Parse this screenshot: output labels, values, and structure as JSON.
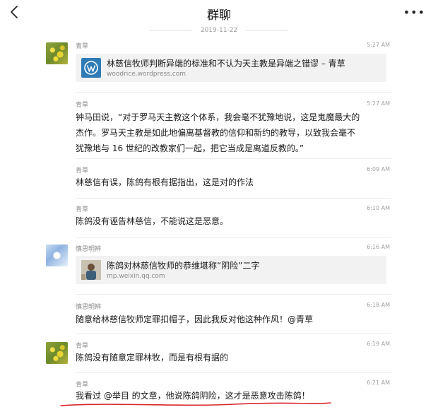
{
  "header": {
    "title": "群聊"
  },
  "date_label": "2019-11-22",
  "messages": [
    {
      "sender": "青草",
      "time": "5:27 AM",
      "card": {
        "title": "林慈信牧师判断异端的标准和不认为天主教是异端之错谬 – 青草",
        "url": "woodrice.wordpress.com"
      }
    },
    {
      "sender": "青草",
      "time": "5:27 AM",
      "lines": [
        "钟马田说，“对于罗马天主教这个体系，我会毫不犹豫地说，这是鬼魔最大的",
        "杰作。罗马天主教是如此地偏离基督教的信仰和新约的教导，以致我会毫不",
        "犹豫地与 16 世纪的改教家们一起，把它当成是离道反教的。”"
      ]
    },
    {
      "sender": "青草",
      "time": "6:09 AM",
      "lines": [
        "林慈信有误，陈鸽有根有据指出，这是对的作法"
      ]
    },
    {
      "sender": "青草",
      "time": "6:10 AM",
      "lines": [
        "陈鸽没有诬告林慈信，不能说这是恶意。"
      ]
    },
    {
      "sender": "慎思明辨",
      "time": "6:16 AM",
      "card": {
        "title": "陈鸽对林慈信牧师的恭维堪称“阴险”二字",
        "url": "mp.weixin.qq.com"
      }
    },
    {
      "sender": "慎思明辨",
      "time": "6:18 AM",
      "lines": [
        "随意给林慈信牧师定罪扣帽子，因此我反对他这种作风！@青草"
      ]
    },
    {
      "sender": "青草",
      "time": "6:19 AM",
      "lines": [
        "陈鸽没有随意定罪林牧，而是有根有据的"
      ]
    },
    {
      "sender": "青草",
      "time": "6:21 AM",
      "lines": [
        "我看过 @举目 的文章，他说陈鸽阴险，这才是恶意攻击陈鸽！"
      ]
    }
  ],
  "colors": {
    "underline": "#d9262b",
    "wordpress": "#2e7bb6"
  }
}
